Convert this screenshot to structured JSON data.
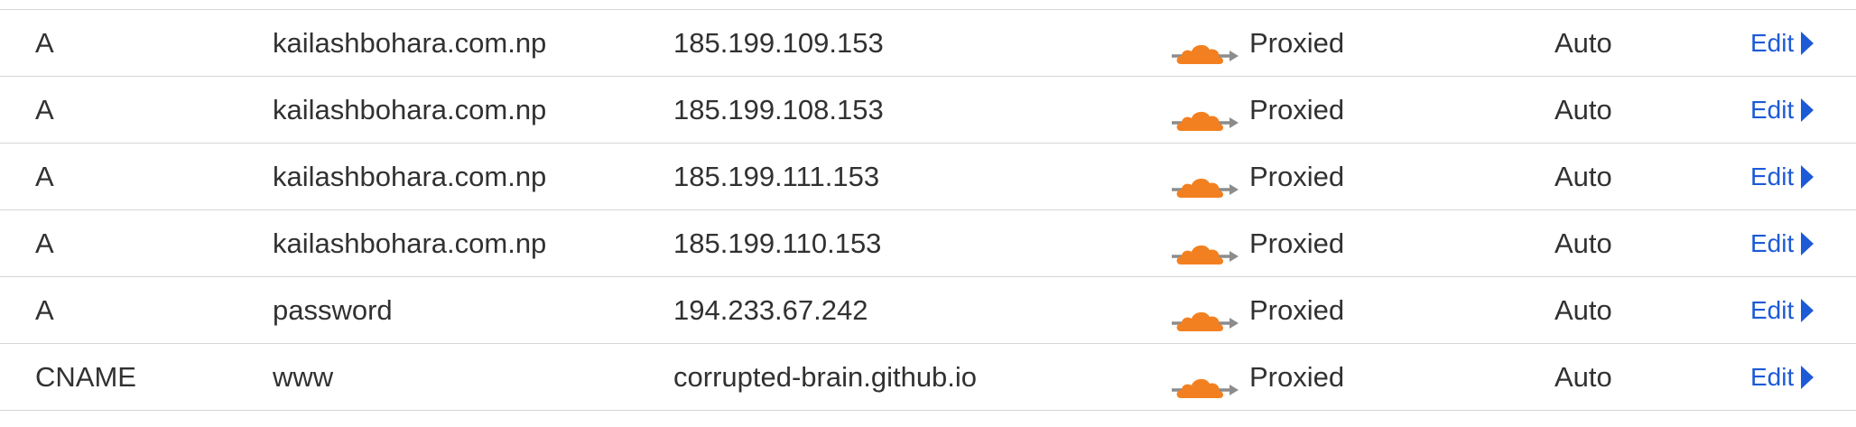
{
  "records": [
    {
      "type": "A",
      "name": "kailashbohara.com.np",
      "content": "185.199.109.153",
      "proxy_status": "Proxied",
      "ttl": "Auto",
      "action": "Edit"
    },
    {
      "type": "A",
      "name": "kailashbohara.com.np",
      "content": "185.199.108.153",
      "proxy_status": "Proxied",
      "ttl": "Auto",
      "action": "Edit"
    },
    {
      "type": "A",
      "name": "kailashbohara.com.np",
      "content": "185.199.111.153",
      "proxy_status": "Proxied",
      "ttl": "Auto",
      "action": "Edit"
    },
    {
      "type": "A",
      "name": "kailashbohara.com.np",
      "content": "185.199.110.153",
      "proxy_status": "Proxied",
      "ttl": "Auto",
      "action": "Edit"
    },
    {
      "type": "A",
      "name": "password",
      "content": "194.233.67.242",
      "proxy_status": "Proxied",
      "ttl": "Auto",
      "action": "Edit"
    },
    {
      "type": "CNAME",
      "name": "www",
      "content": "corrupted-brain.github.io",
      "proxy_status": "Proxied",
      "ttl": "Auto",
      "action": "Edit"
    }
  ],
  "icons": {
    "proxy": "orange-cloud-icon",
    "expand": "caret-right-icon"
  },
  "colors": {
    "cloud": "#f38020",
    "arrow": "#8c8c8c",
    "link": "#1d5ad6",
    "divider": "#d6d6d6",
    "text": "#313131"
  }
}
